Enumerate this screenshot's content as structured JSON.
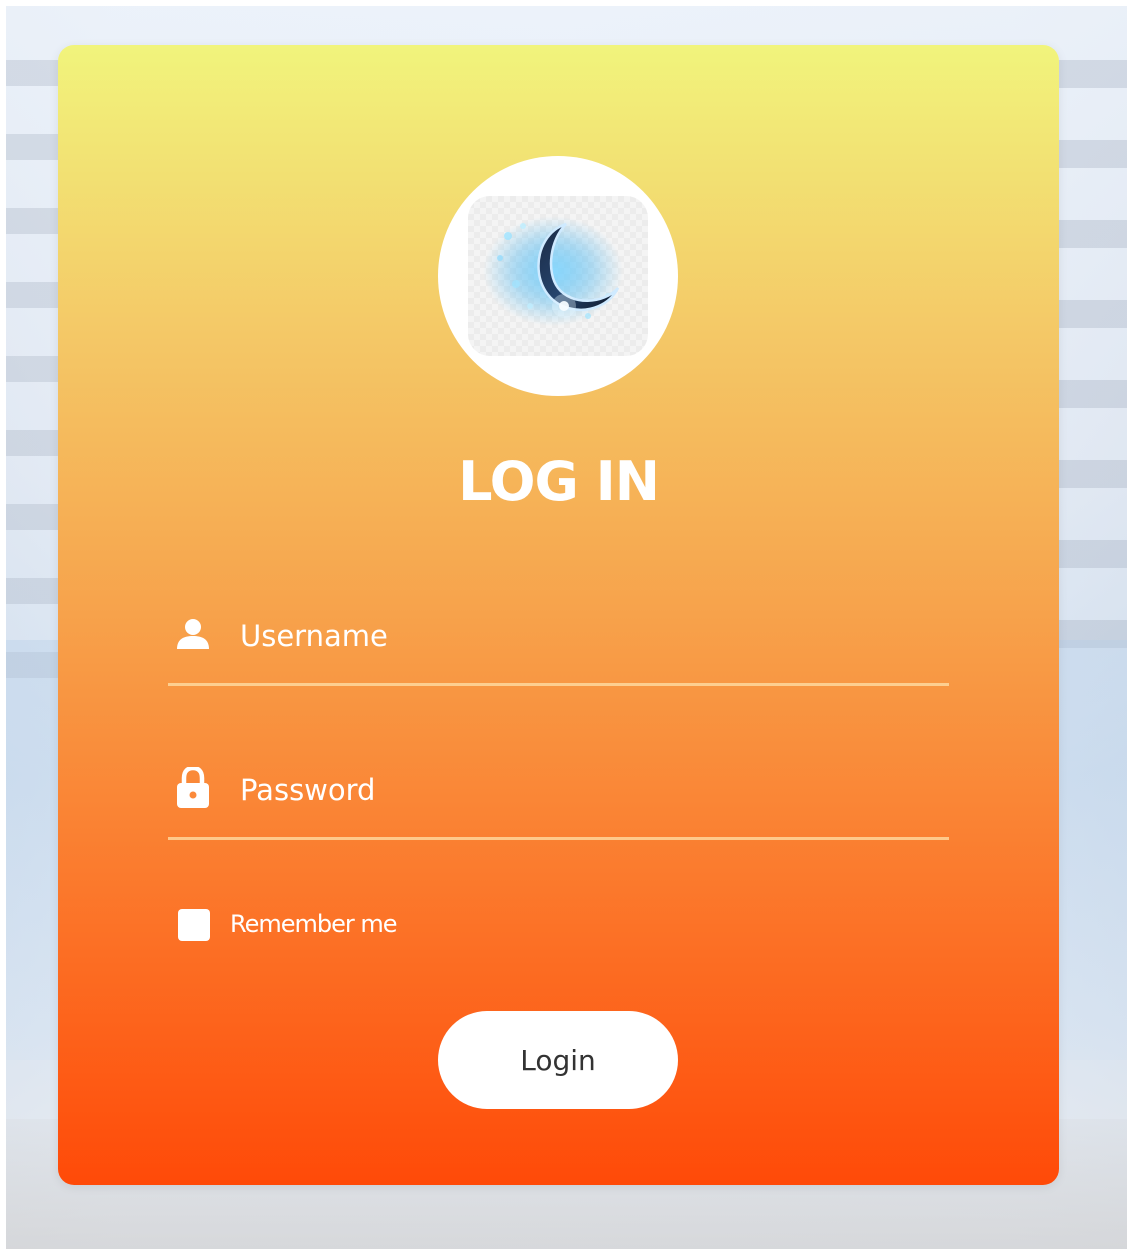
{
  "form": {
    "title": "LOG IN",
    "username": {
      "placeholder": "Username",
      "value": "",
      "icon": "user-icon"
    },
    "password": {
      "placeholder": "Password",
      "value": "",
      "icon": "lock-icon"
    },
    "remember": {
      "label": "Remember me",
      "checked": false
    },
    "submit_label": "Login"
  },
  "logo": {
    "icon": "crescent-moon-icon"
  },
  "colors": {
    "gradient_top": "#f1f47c",
    "gradient_bottom": "#ff4a08",
    "text": "#ffffff",
    "button_text": "#333333"
  }
}
